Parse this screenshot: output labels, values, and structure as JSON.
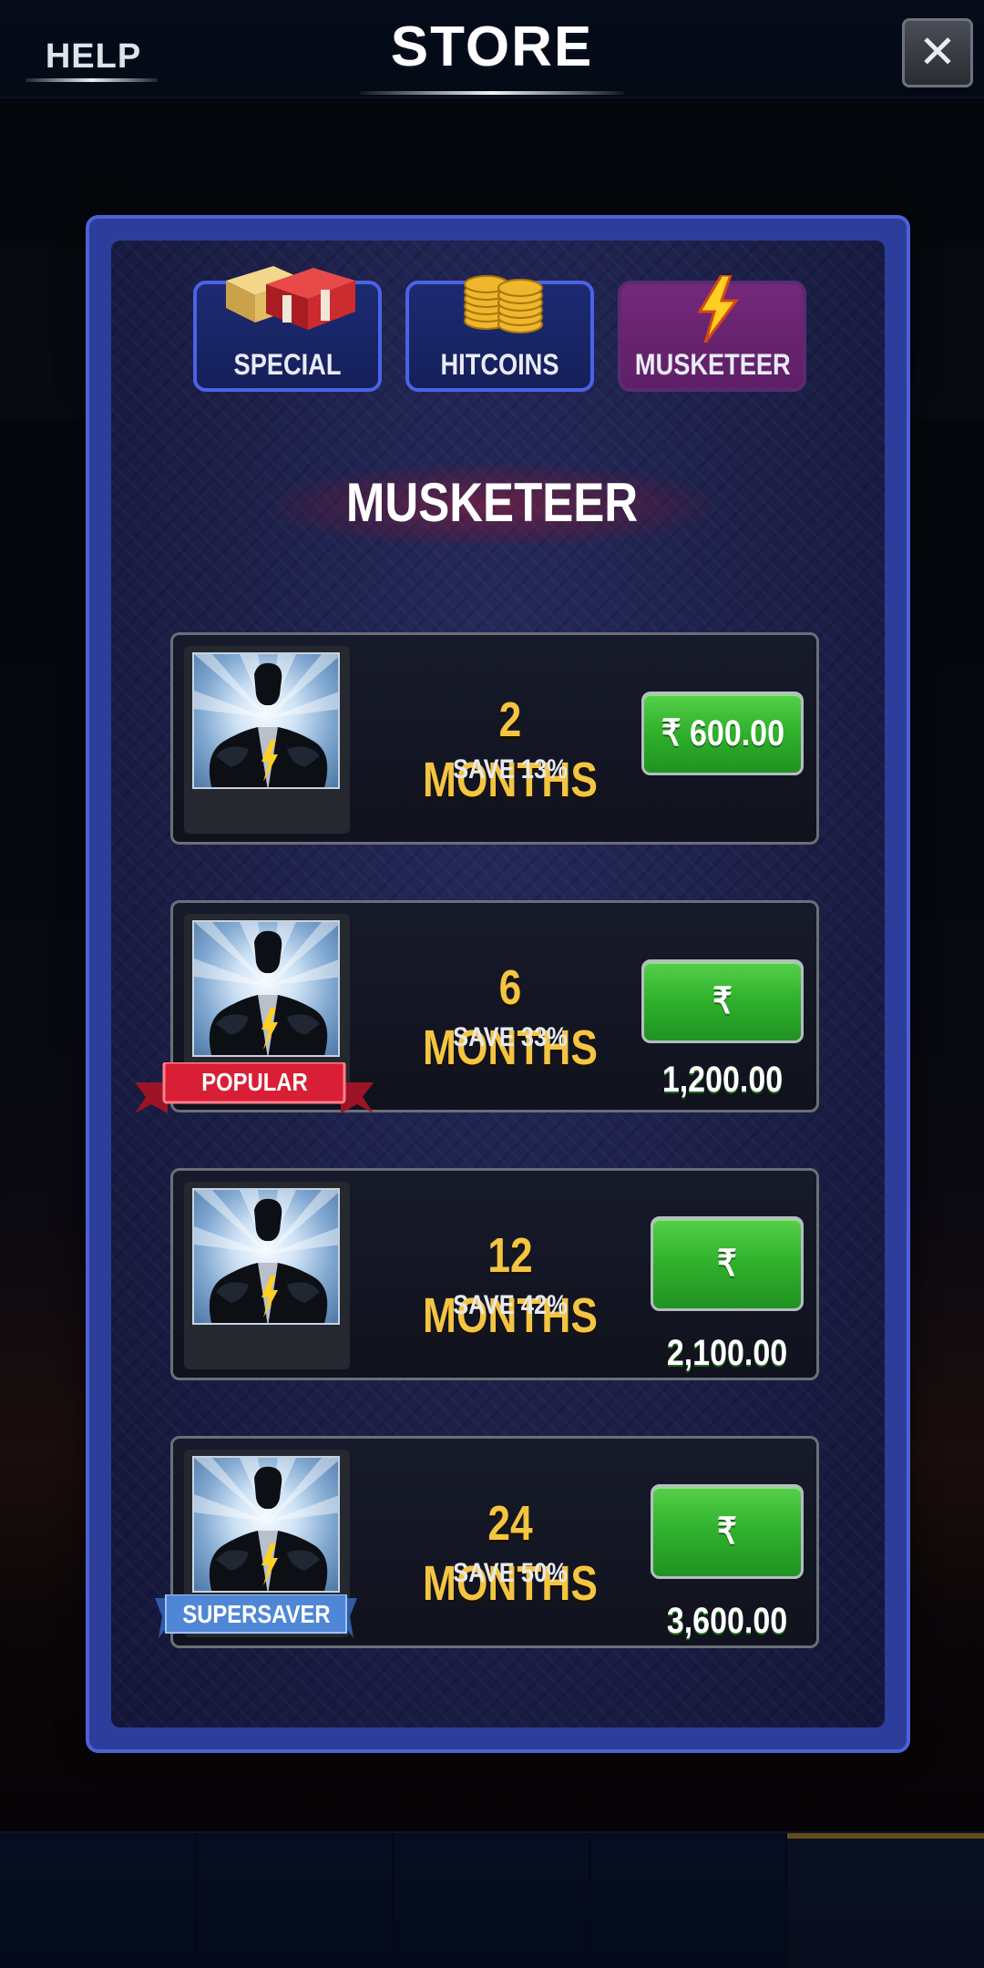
{
  "header": {
    "help_label": "HELP",
    "title": "STORE",
    "close_icon": "close-icon"
  },
  "tabs": [
    {
      "label": "SPECIAL",
      "icon": "chest-icon",
      "active": false
    },
    {
      "label": "HITCOINS",
      "icon": "coins-icon",
      "active": false
    },
    {
      "label": "MUSKETEER",
      "icon": "lightning-icon",
      "active": true
    }
  ],
  "section": {
    "title": "MUSKETEER"
  },
  "packages": [
    {
      "duration": "2 MONTHS",
      "save": "SAVE 13%",
      "price": "₹ 600.00",
      "badge": ""
    },
    {
      "duration": "6 MONTHS",
      "save": "SAVE 33%",
      "price": "₹ 1,200.00",
      "badge": "POPULAR"
    },
    {
      "duration": "12 MONTHS",
      "save": "SAVE 42%",
      "price": "₹ 2,100.00",
      "badge": ""
    },
    {
      "duration": "24 MONTHS",
      "save": "SAVE 50%",
      "price": "₹ 3,600.00",
      "badge": "SUPERSAVER"
    }
  ],
  "colors": {
    "modal_border": "#4e62d6",
    "tab_active": "#74287a",
    "duration_text": "#f4c542",
    "price_button": "#2fb02b",
    "popular_ribbon": "#d81f35",
    "supersaver_ribbon": "#4f86d6"
  }
}
